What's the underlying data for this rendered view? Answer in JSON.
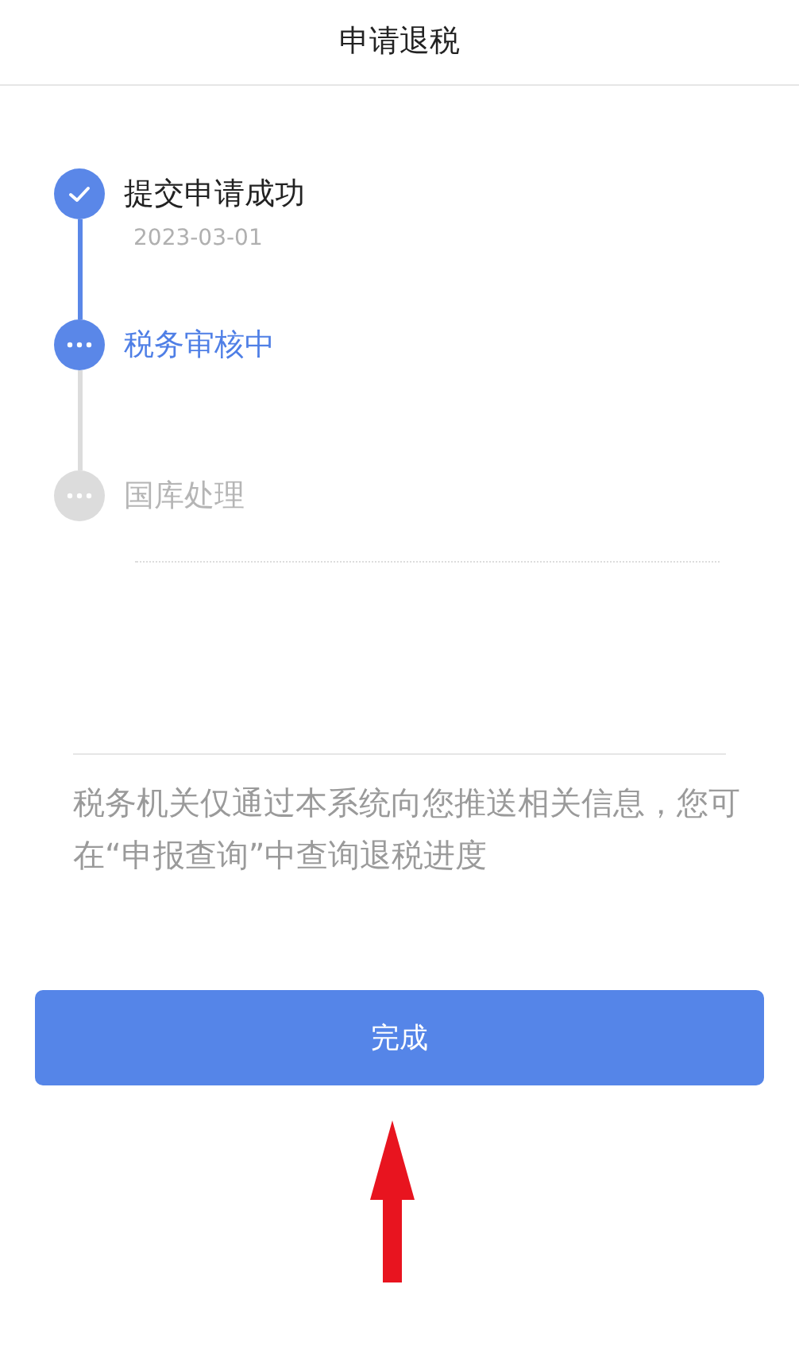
{
  "header": {
    "title": "申请退税"
  },
  "steps": [
    {
      "label": "提交申请成功",
      "date": "2023-03-01",
      "kind": "done"
    },
    {
      "label": "税务审核中",
      "kind": "active"
    },
    {
      "label": "国库处理",
      "kind": "pending"
    }
  ],
  "notice": "税务机关仅通过本系统向您推送相关信息，您可在“申报查询”中查询退税进度",
  "button": {
    "label": "完成"
  }
}
